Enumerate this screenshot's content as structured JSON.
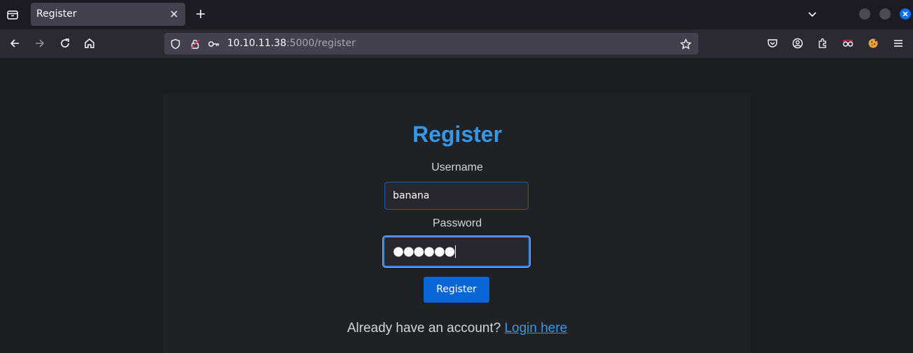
{
  "browser": {
    "tab": {
      "title": "Register"
    },
    "url": {
      "host": "10.10.11.38",
      "rest": ":5000/register"
    }
  },
  "form": {
    "heading": "Register",
    "username_label": "Username",
    "username_value": "banana",
    "password_label": "Password",
    "password_masked": "●●●●●●",
    "submit_label": "Register",
    "footer_text": "Already have an account?",
    "login_link": "Login here"
  },
  "colors": {
    "accent": "#3597e6",
    "button": "#0a66d4"
  }
}
